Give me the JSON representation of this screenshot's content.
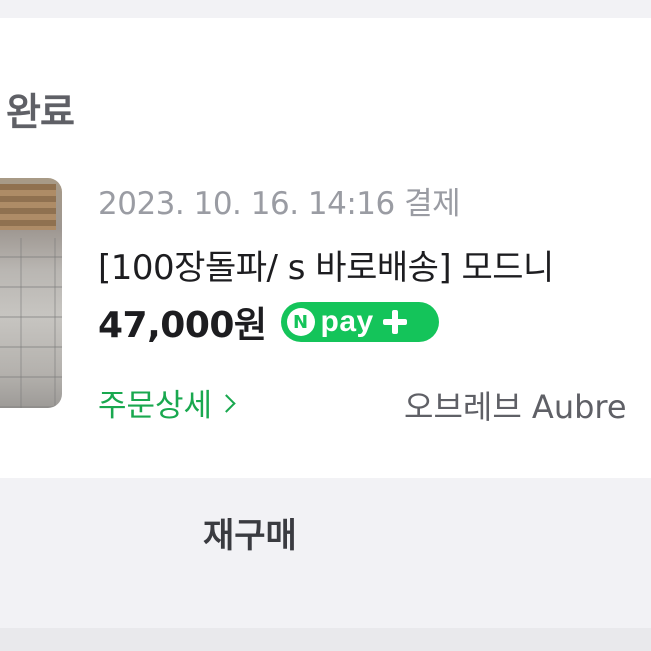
{
  "order": {
    "status": "완료",
    "date": "2023. 10. 16. 14:16 결제",
    "product_title": "[100장돌파/ s 바로배송] 모드니",
    "price": "47,000원",
    "pay_badge": {
      "icon_letter": "N",
      "label": "pay",
      "plus_icon": "plus-icon",
      "color": "#14c45a"
    },
    "detail_link": "주문상세",
    "seller": "오브레브 Aubre"
  },
  "actions": {
    "rebuy_label": "재구매"
  },
  "colors": {
    "accent_green": "#19a84f",
    "background": "#f2f2f5",
    "card": "#ffffff"
  }
}
